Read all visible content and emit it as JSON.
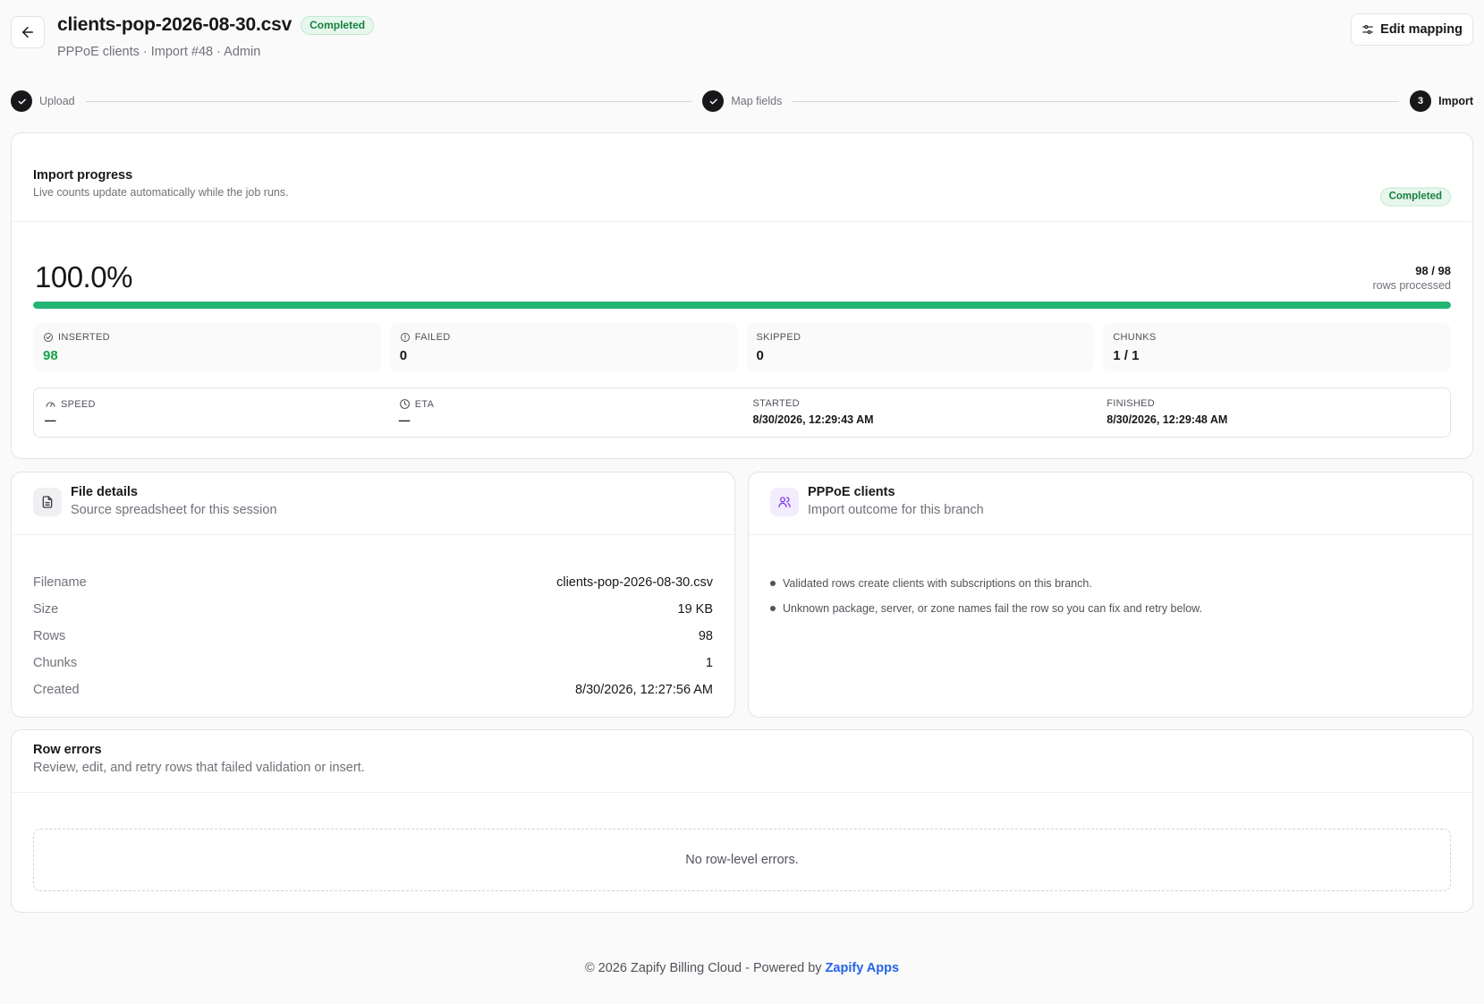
{
  "header": {
    "title": "clients-pop-2026-08-30.csv",
    "status_badge": "Completed",
    "subtitle": "PPPoE clients · Import #48 · Admin",
    "edit_button": "Edit mapping"
  },
  "stepper": {
    "steps": [
      {
        "label": "Upload",
        "state": "done"
      },
      {
        "label": "Map fields",
        "state": "done"
      },
      {
        "label": "Import",
        "number": "3",
        "state": "active"
      }
    ]
  },
  "progress": {
    "title": "Import progress",
    "description": "Live counts update automatically while the job runs.",
    "status_badge": "Completed",
    "percent_text": "100.0%",
    "progress_fraction": 1.0,
    "rows_count": "98 / 98",
    "rows_label": "rows processed",
    "stats": [
      {
        "label": "INSERTED",
        "value": "98"
      },
      {
        "label": "FAILED",
        "value": "0"
      },
      {
        "label": "SKIPPED",
        "value": "0"
      },
      {
        "label": "CHUNKS",
        "value": "1 / 1"
      }
    ],
    "timing": [
      {
        "label": "SPEED",
        "value": "—"
      },
      {
        "label": "ETA",
        "value": "—"
      },
      {
        "label": "STARTED",
        "value": "8/30/2026, 12:29:43 AM"
      },
      {
        "label": "FINISHED",
        "value": "8/30/2026, 12:29:48 AM"
      }
    ]
  },
  "file_details": {
    "title": "File details",
    "description": "Source spreadsheet for this session",
    "rows": [
      {
        "key": "Filename",
        "value": "clients-pop-2026-08-30.csv"
      },
      {
        "key": "Size",
        "value": "19 KB"
      },
      {
        "key": "Rows",
        "value": "98"
      },
      {
        "key": "Chunks",
        "value": "1"
      },
      {
        "key": "Created",
        "value": "8/30/2026, 12:27:56 AM"
      }
    ]
  },
  "clients_panel": {
    "title": "PPPoE clients",
    "description": "Import outcome for this branch",
    "bullets": [
      "Validated rows create clients with subscriptions on this branch.",
      "Unknown package, server, or zone names fail the row so you can fix and retry below."
    ]
  },
  "row_errors": {
    "title": "Row errors",
    "description": "Review, edit, and retry rows that failed validation or insert.",
    "empty_text": "No row-level errors."
  },
  "footer": {
    "text": "© 2026 Zapify Billing Cloud - Powered by ",
    "link": "Zapify Apps"
  },
  "colors": {
    "accent_green": "#22b573",
    "link_blue": "#2563eb",
    "purple_icon": "#7c3aed"
  }
}
